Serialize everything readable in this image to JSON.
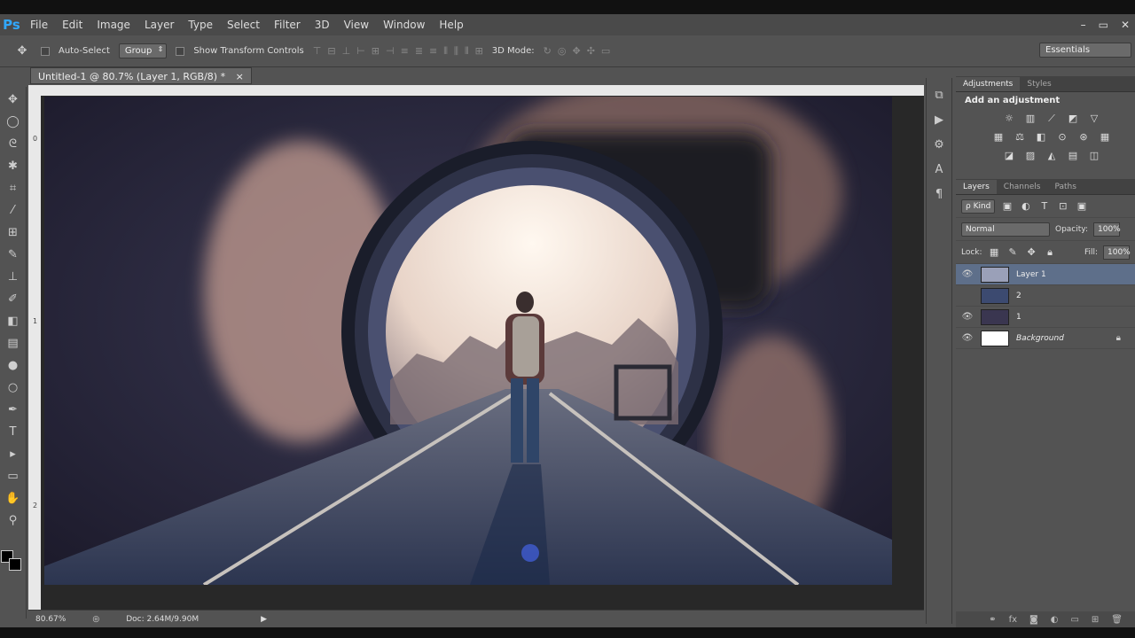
{
  "app": {
    "logo": "Ps",
    "window_controls": [
      "–",
      "▭",
      "✕"
    ]
  },
  "menu": [
    "File",
    "Edit",
    "Image",
    "Layer",
    "Type",
    "Select",
    "Filter",
    "3D",
    "View",
    "Window",
    "Help"
  ],
  "options": {
    "auto_select_label": "Auto-Select",
    "auto_select_value": "Group",
    "show_transform_label": "Show Transform Controls",
    "mode_3d_label": "3D Mode:",
    "workspace": "Essentials"
  },
  "document": {
    "tab_title": "Untitled-1 @ 80.7% (Layer 1, RGB/8) *",
    "close": "×",
    "ruler_left_marks": [
      "0",
      "1",
      "2"
    ]
  },
  "status": {
    "zoom": "80.67%",
    "doc_size": "Doc: 2.64M/9.90M"
  },
  "adjustments": {
    "tabs": [
      "Adjustments",
      "Styles"
    ],
    "title": "Add an adjustment",
    "rows": [
      [
        "brightness-icon",
        "levels-icon",
        "curves-icon",
        "exposure-icon",
        "vibrance-icon"
      ],
      [
        "hue-icon",
        "color-balance-icon",
        "bw-icon",
        "photo-filter-icon",
        "channel-mixer-icon",
        "color-lookup-icon"
      ],
      [
        "invert-icon",
        "posterize-icon",
        "threshold-icon",
        "gradient-map-icon",
        "selective-color-icon"
      ]
    ]
  },
  "layers": {
    "tabs": [
      "Layers",
      "Channels",
      "Paths"
    ],
    "kind": "ρ Kind",
    "blend_mode": "Normal",
    "opacity_label": "Opacity:",
    "opacity": "100%",
    "lock_label": "Lock:",
    "fill_label": "Fill:",
    "fill": "100%",
    "items": [
      {
        "name": "Layer 1",
        "visible": true,
        "selected": true
      },
      {
        "name": "2",
        "visible": false,
        "selected": false
      },
      {
        "name": "1",
        "visible": true,
        "selected": false
      },
      {
        "name": "Background",
        "visible": true,
        "selected": false,
        "locked": true
      }
    ]
  },
  "colors": {
    "accent": "#31a8ff",
    "selected_layer": "#5e6f8a",
    "panel_bg": "#535353"
  }
}
